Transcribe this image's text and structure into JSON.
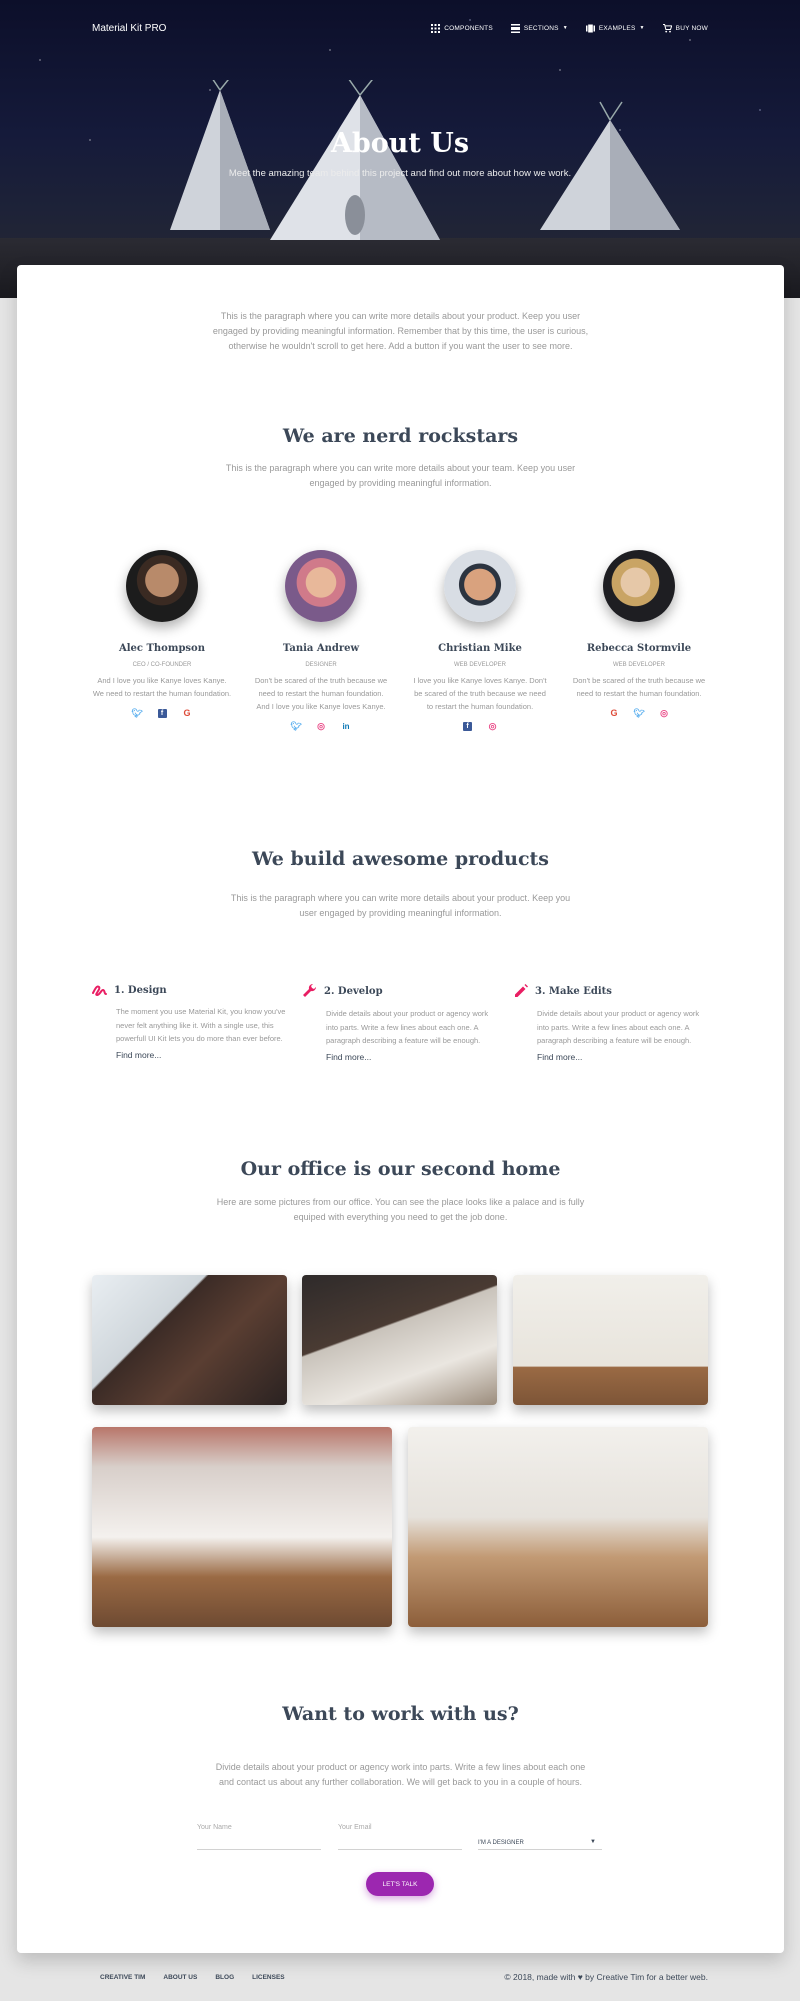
{
  "nav": {
    "brand": "Material Kit PRO",
    "links": [
      {
        "label": "Components",
        "icon": "apps-icon"
      },
      {
        "label": "Sections",
        "icon": "view-day-icon"
      },
      {
        "label": "Examples",
        "icon": "view-carousel-icon"
      },
      {
        "label": "Buy Now",
        "icon": "shopping-cart-icon"
      }
    ]
  },
  "hero": {
    "title": "About Us",
    "subtitle": "Meet the amazing team behind this project and find out more about how we work."
  },
  "intro": "This is the paragraph where you can write more details about your product. Keep you user engaged by providing meaningful information. Remember that by this time, the user is curious, otherwise he wouldn't scroll to get here. Add a button if you want the user to see more.",
  "team": {
    "title": "We are nerd rockstars",
    "description": "This is the paragraph where you can write more details about your team. Keep you user engaged by providing meaningful information.",
    "members": [
      {
        "name": "Alec Thompson",
        "role": "CEO / Co-Founder",
        "description": "And I love you like Kanye loves Kanye. We need to restart the human foundation.",
        "socials": [
          "twitter-icon",
          "facebook-icon",
          "google-icon"
        ]
      },
      {
        "name": "Tania Andrew",
        "role": "Designer",
        "description": "Don't be scared of the truth because we need to restart the human foundation. And I love you like Kanye loves Kanye.",
        "socials": [
          "twitter-icon",
          "dribbble-icon",
          "linkedin-icon"
        ]
      },
      {
        "name": "Christian Mike",
        "role": "Web Developer",
        "description": "I love you like Kanye loves Kanye. Don't be scared of the truth because we need to restart the human foundation.",
        "socials": [
          "facebook-icon",
          "dribbble-icon"
        ]
      },
      {
        "name": "Rebecca Stormvile",
        "role": "Web Developer",
        "description": "Don't be scared of the truth because we need to restart the human foundation.",
        "socials": [
          "google-icon",
          "twitter-icon",
          "dribbble-icon"
        ]
      }
    ]
  },
  "products": {
    "title": "We build awesome products",
    "description": "This is the paragraph where you can write more details about your product. Keep you user engaged by providing meaningful information.",
    "features": [
      {
        "title": "1. Design",
        "icon": "gesture-icon",
        "description": "The moment you use Material Kit, you know you've never felt anything like it. With a single use, this powerfull UI Kit lets you do more than ever before.",
        "link": "Find more..."
      },
      {
        "title": "2. Develop",
        "icon": "build-icon",
        "description": "Divide details about your product or agency work into parts. Write a few lines about each one. A paragraph describing a feature will be enough.",
        "link": "Find more..."
      },
      {
        "title": "3. Make Edits",
        "icon": "mode-edit-icon",
        "description": "Divide details about your product or agency work into parts. Write a few lines about each one. A paragraph describing a feature will be enough.",
        "link": "Find more..."
      }
    ]
  },
  "office": {
    "title": "Our office is our second home",
    "description": "Here are some pictures from our office. You can see the place looks like a palace and is fully equiped with everything you need to get the job done."
  },
  "contact": {
    "title": "Want to work with us?",
    "description": "Divide details about your product or agency work into parts. Write a few lines about each one and contact us about any further collaboration. We will get back to you in a couple of hours.",
    "name_label": "Your Name",
    "email_label": "Your Email",
    "select_value": "I'm a Designer",
    "button_label": "Let's talk"
  },
  "footer": {
    "links": [
      "Creative Tim",
      "About Us",
      "Blog",
      "Licenses"
    ],
    "copyright_prefix": "© 2018, made with",
    "copyright_suffix": "by Creative Tim for a better web."
  },
  "colors": {
    "accent": "#e91e63",
    "primary": "#9c27b0",
    "twitter": "#55acee",
    "facebook": "#3b5998",
    "google": "#dd4b39",
    "dribbble": "#ea4c89",
    "linkedin": "#0976b4"
  }
}
